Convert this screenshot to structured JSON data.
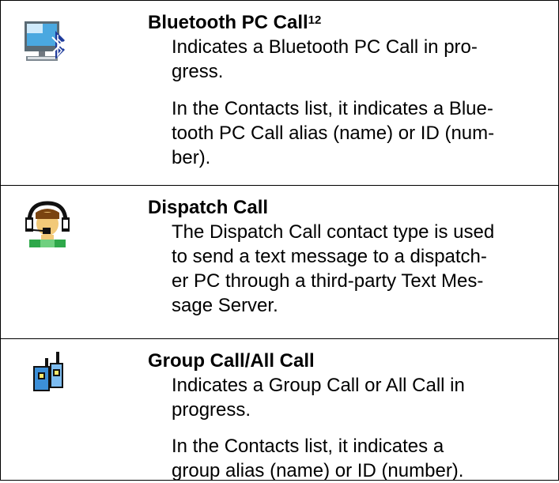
{
  "rows": [
    {
      "icon": "bluetooth-pc-call-icon",
      "title": "Bluetooth PC Call",
      "superscript": "12",
      "paragraphs": [
        [
          "Indicates a Bluetooth PC Call in pro-",
          "gress."
        ],
        [
          "In the Contacts list, it indicates a Blue-",
          "tooth PC Call alias (name) or ID (num-",
          "ber)."
        ]
      ]
    },
    {
      "icon": "dispatch-call-icon",
      "title": "Dispatch Call",
      "paragraphs": [
        [
          "The Dispatch Call contact type is used",
          "to send a text message to a dispatch-",
          "er PC through a third-party Text Mes-",
          "sage Server."
        ]
      ]
    },
    {
      "icon": "group-call-icon",
      "title": "Group Call/All Call",
      "paragraphs": [
        [
          "Indicates a Group Call or All Call in",
          "progress."
        ],
        [
          "In the Contacts list, it indicates a",
          "group alias (name) or ID (number)."
        ]
      ]
    }
  ]
}
